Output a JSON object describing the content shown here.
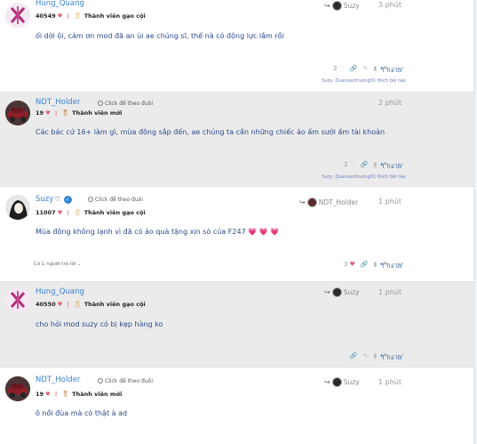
{
  "colors": {
    "username": "#3c82d6",
    "body_text": "#2b4a8a",
    "post_grey": "#ebebeb",
    "heart": "#e0657a",
    "link": "#3a6aa8"
  },
  "posts": [
    {
      "username": "Hung_Quang",
      "count": "40549",
      "rank": "Thành viên gạo cội",
      "reply_to": "Suzy",
      "time": "3 phút",
      "body": "ối dời ôi, cảm ơn mod đã an ủi ae chúng sĩ, thế nà có động lực lắm rồi",
      "likes": "2",
      "reply_label": "Trả lời",
      "likers": "Suzy, Quanvantruong01 thích bài này"
    },
    {
      "username": "NDT_Holder",
      "follow": "Click để theo đuôi",
      "count": "19",
      "rank": "Thành viên mới",
      "time": "2 phút",
      "body": "Các bác cứ 16+ làm gì, mùa đông sắp đến, ae chúng ta cần những chiếc áo ấm sưởi ấm tài khoản",
      "likes": "2",
      "reply_label": "Trả lời",
      "likers": "Suzy, Quanvantruong01 thích bài này"
    },
    {
      "username": "Suzy",
      "follow": "Click để theo đuôi",
      "count": "11007",
      "rank": "Thành viên gạo cội",
      "reply_to": "NDT_Holder",
      "time": "1 phút",
      "body": "Mùa đông không lạnh vì đã có áo quà tặng xịn sò của F247 💗 💗 💗",
      "replies": "Có 1 người trả lời",
      "likes": "3",
      "reply_label": "Trả lời"
    },
    {
      "username": "Hung_Quang",
      "count": "40550",
      "rank": "Thành viên gạo cội",
      "reply_to": "Suzy",
      "time": "1 phút",
      "body": "cho hỏi mod suzy có bị kẹp hàng ko",
      "reply_label": "Trả lời"
    },
    {
      "username": "NDT_Holder",
      "follow": "Click để theo đuôi",
      "count": "19",
      "rank": "Thành viên mới",
      "reply_to": "Suzy",
      "time": "1 phút",
      "body": "ô nồi đùa mà có thật à ad"
    }
  ]
}
